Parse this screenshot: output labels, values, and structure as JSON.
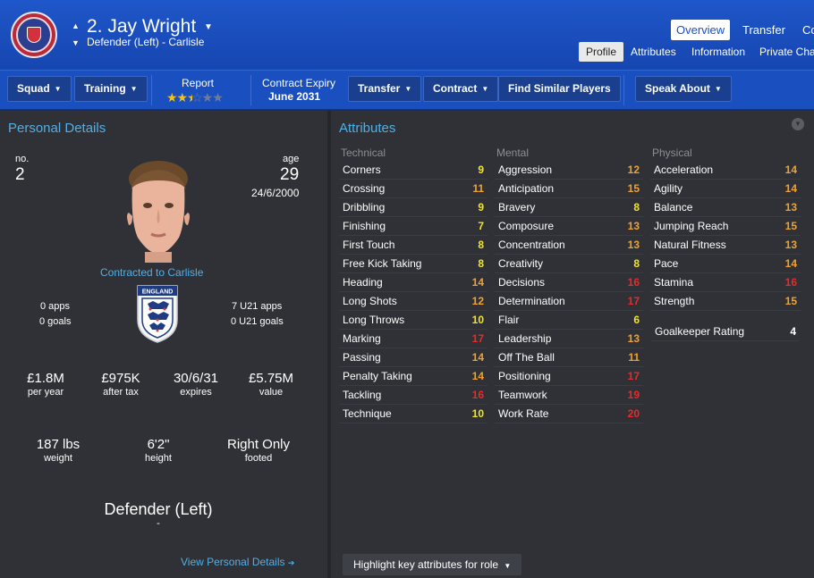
{
  "header": {
    "player_name": "2. Jay Wright",
    "player_sub": "Defender (Left) - Carlisle",
    "tabs": [
      "Overview",
      "Transfer",
      "Co"
    ],
    "sub_tabs": [
      "Profile",
      "Attributes",
      "Information",
      "Private Chat"
    ]
  },
  "toolbar": {
    "squad": "Squad",
    "training": "Training",
    "report_label": "Report",
    "report_stars": 2.5,
    "report_stars_max": 5,
    "contract_label": "Contract Expiry",
    "contract_value": "June 2031",
    "transfer": "Transfer",
    "contract": "Contract",
    "find_similar": "Find Similar Players",
    "speak_about": "Speak About"
  },
  "personal": {
    "title": "Personal Details",
    "no_label": "no.",
    "no_value": "2",
    "age_label": "age",
    "age_value": "29",
    "dob": "24/6/2000",
    "contracted": "Contracted to Carlisle",
    "apps": "0 apps",
    "goals": "0 goals",
    "u21_apps": "7 U21 apps",
    "u21_goals": "0 U21 goals",
    "badge_text": "ENGLAND",
    "wage_value": "£1.8M",
    "wage_label": "per year",
    "aftertax_value": "£975K",
    "aftertax_label": "after tax",
    "expires_value": "30/6/31",
    "expires_label": "expires",
    "value_value": "£5.75M",
    "value_label": "value",
    "weight_value": "187 lbs",
    "weight_label": "weight",
    "height_value": "6'2\"",
    "height_label": "height",
    "footed_value": "Right Only",
    "footed_label": "footed",
    "position": "Defender (Left)",
    "position_sub": "-",
    "view_link": "View Personal Details"
  },
  "attributes": {
    "title": "Attributes",
    "technical_head": "Technical",
    "mental_head": "Mental",
    "physical_head": "Physical",
    "technical": [
      {
        "name": "Corners",
        "value": "9"
      },
      {
        "name": "Crossing",
        "value": "11"
      },
      {
        "name": "Dribbling",
        "value": "9"
      },
      {
        "name": "Finishing",
        "value": "7"
      },
      {
        "name": "First Touch",
        "value": "8"
      },
      {
        "name": "Free Kick Taking",
        "value": "8"
      },
      {
        "name": "Heading",
        "value": "14"
      },
      {
        "name": "Long Shots",
        "value": "12"
      },
      {
        "name": "Long Throws",
        "value": "10"
      },
      {
        "name": "Marking",
        "value": "17"
      },
      {
        "name": "Passing",
        "value": "14"
      },
      {
        "name": "Penalty Taking",
        "value": "14"
      },
      {
        "name": "Tackling",
        "value": "16"
      },
      {
        "name": "Technique",
        "value": "10"
      }
    ],
    "mental": [
      {
        "name": "Aggression",
        "value": "12"
      },
      {
        "name": "Anticipation",
        "value": "15"
      },
      {
        "name": "Bravery",
        "value": "8"
      },
      {
        "name": "Composure",
        "value": "13"
      },
      {
        "name": "Concentration",
        "value": "13"
      },
      {
        "name": "Creativity",
        "value": "8"
      },
      {
        "name": "Decisions",
        "value": "16"
      },
      {
        "name": "Determination",
        "value": "17"
      },
      {
        "name": "Flair",
        "value": "6"
      },
      {
        "name": "Leadership",
        "value": "13"
      },
      {
        "name": "Off The Ball",
        "value": "11"
      },
      {
        "name": "Positioning",
        "value": "17"
      },
      {
        "name": "Teamwork",
        "value": "19"
      },
      {
        "name": "Work Rate",
        "value": "20"
      }
    ],
    "physical": [
      {
        "name": "Acceleration",
        "value": "14"
      },
      {
        "name": "Agility",
        "value": "14"
      },
      {
        "name": "Balance",
        "value": "13"
      },
      {
        "name": "Jumping Reach",
        "value": "15"
      },
      {
        "name": "Natural Fitness",
        "value": "13"
      },
      {
        "name": "Pace",
        "value": "14"
      },
      {
        "name": "Stamina",
        "value": "16"
      },
      {
        "name": "Strength",
        "value": "15"
      }
    ],
    "gk_label": "Goalkeeper Rating",
    "gk_value": "4",
    "highlight_button": "Highlight key attributes for role",
    "colors": {
      "low": "#f3e31f",
      "mid": "#f3a12c",
      "high": "#f02727"
    }
  }
}
